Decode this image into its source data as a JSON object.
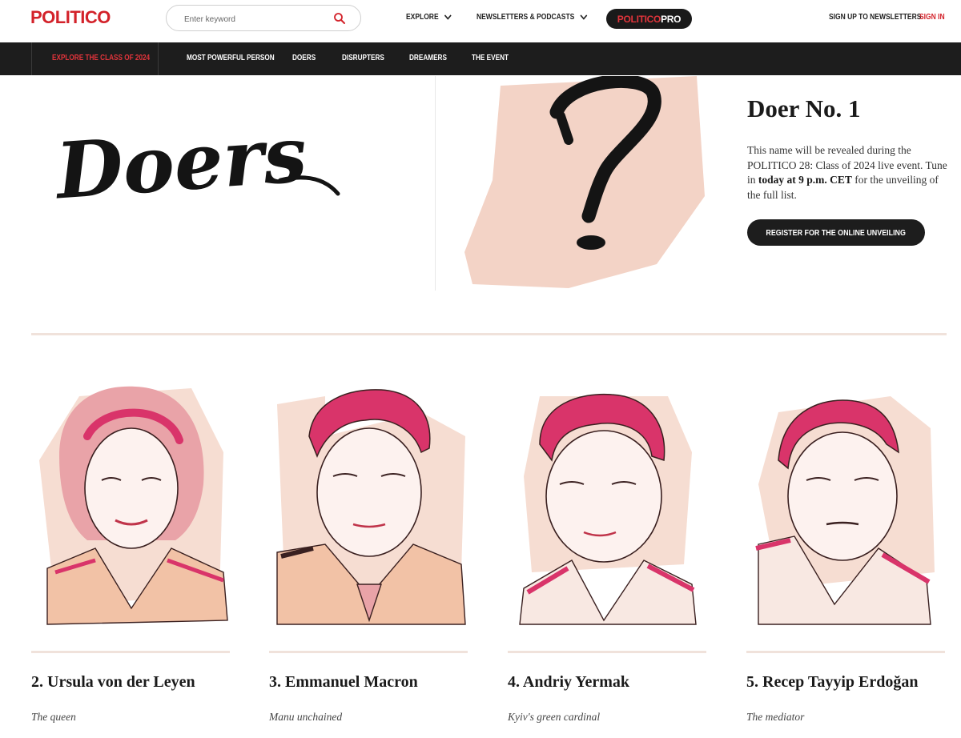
{
  "header": {
    "logo": "POLITICO",
    "search_placeholder": "Enter keyword",
    "nav": [
      {
        "label": "EXPLORE"
      },
      {
        "label": "NEWSLETTERS & PODCASTS"
      }
    ],
    "pro_badge": {
      "part1": "POLITICO",
      "part2": "PRO"
    },
    "signup_label": "SIGN UP TO NEWSLETTERS",
    "signin_label": "SIGN IN"
  },
  "subnav": {
    "items": [
      {
        "label": "EXPLORE THE CLASS OF 2024",
        "active": true
      },
      {
        "label": "MOST POWERFUL PERSON"
      },
      {
        "label": "DOERS"
      },
      {
        "label": "DISRUPTERS"
      },
      {
        "label": "DREAMERS"
      },
      {
        "label": "THE EVENT"
      }
    ]
  },
  "hero": {
    "category_art_text": "Doers",
    "title": "Doer No. 1",
    "desc_part1": "This name will be revealed during the POLITICO 28: Class of 2024 live event. Tune in ",
    "desc_bold": "today at 9 p.m. CET",
    "desc_part2": " for the unveiling of the full list.",
    "button_label": "REGISTER FOR THE ONLINE UNVEILING"
  },
  "colors": {
    "brand_red": "#d3222a",
    "dark": "#1d1d1d",
    "blush": "#f3d3c6",
    "accent_pink": "#e0446a"
  },
  "cards": [
    {
      "name": "2. Ursula von der Leyen",
      "tagline": "The queen"
    },
    {
      "name": "3. Emmanuel Macron",
      "tagline": "Manu unchained"
    },
    {
      "name": "4. Andriy Yermak",
      "tagline": "Kyiv's green cardinal"
    },
    {
      "name": "5. Recep Tayyip Erdoğan",
      "tagline": "The mediator"
    }
  ]
}
